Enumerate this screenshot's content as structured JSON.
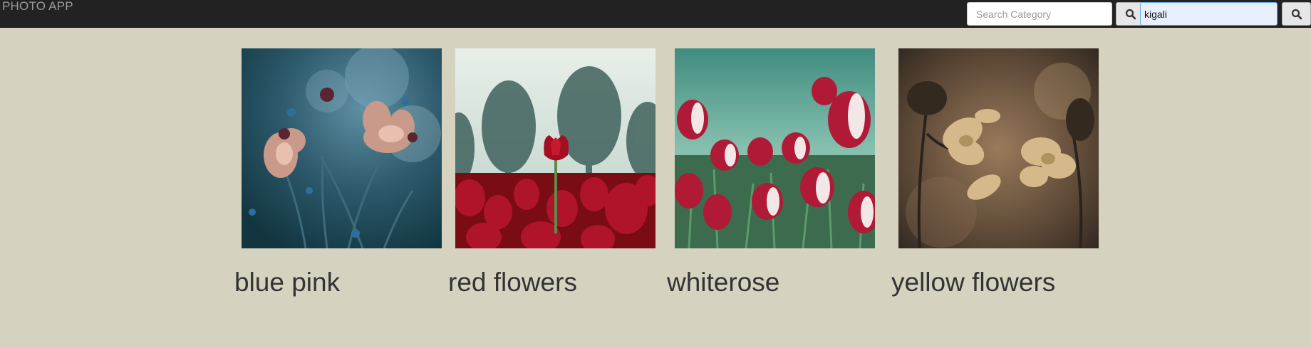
{
  "app": {
    "brand": "PHOTO APP"
  },
  "search": {
    "category_placeholder": "Search Category",
    "category_value": "",
    "city_value": "kigali",
    "search_icon": "search-icon"
  },
  "gallery": {
    "items": [
      {
        "caption": "blue pink",
        "image": "blue-pink-flowers-photo"
      },
      {
        "caption": "red flowers",
        "image": "red-tulips-photo"
      },
      {
        "caption": "whiterose",
        "image": "white-red-tulips-photo"
      },
      {
        "caption": "yellow flowers",
        "image": "dried-yellow-flowers-photo"
      }
    ]
  }
}
